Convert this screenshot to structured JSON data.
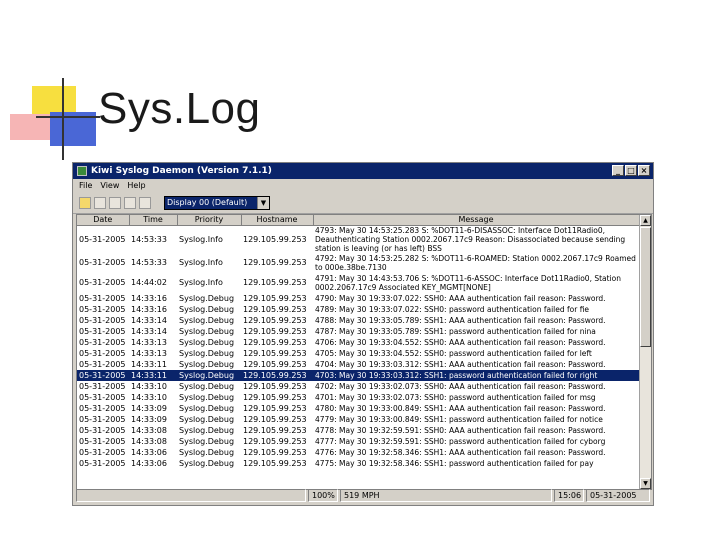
{
  "slide": {
    "title": "Sys.Log"
  },
  "window": {
    "title": "Kiwi Syslog Daemon (Version 7.1.1)",
    "buttons": {
      "minimize": "_",
      "maximize": "□",
      "close": "×"
    }
  },
  "menu": [
    "File",
    "View",
    "Help"
  ],
  "toolbar": {
    "display_value": "Display 00 (Default)"
  },
  "table": {
    "headers": [
      "Date",
      "Time",
      "Priority",
      "Hostname",
      "Message"
    ],
    "rows": [
      {
        "date": "05-31-2005",
        "time": "14:53:33",
        "priority": "Syslog.Info",
        "host": "129.105.99.253",
        "msg": "4793: May 30 14:53:25.283 S: %DOT11-6-DISASSOC: Interface Dot11Radio0, Deauthenticating Station 0002.2067.17c9 Reason: Disassociated because sending station is leaving (or has left) BSS",
        "tall": true
      },
      {
        "date": "05-31-2005",
        "time": "14:53:33",
        "priority": "Syslog.Info",
        "host": "129.105.99.253",
        "msg": "4792: May 30 14:53:25.282 S: %DOT11-6-ROAMED: Station 0002.2067.17c9 Roamed to 000e.38be.7130",
        "tall": true
      },
      {
        "date": "05-31-2005",
        "time": "14:44:02",
        "priority": "Syslog.Info",
        "host": "129.105.99.253",
        "msg": "4791: May 30 14:43:53.706 S: %DOT11-6-ASSOC: Interface Dot11Radio0, Station 0002.2067.17c9 Associated KEY_MGMT[NONE]",
        "tall": true
      },
      {
        "date": "05-31-2005",
        "time": "14:33:16",
        "priority": "Syslog.Debug",
        "host": "129.105.99.253",
        "msg": "4790: May 30 19:33:07.022: SSH0: AAA authentication fail reason: Password."
      },
      {
        "date": "05-31-2005",
        "time": "14:33:16",
        "priority": "Syslog.Debug",
        "host": "129.105.99.253",
        "msg": "4789: May 30 19:33:07.022: SSH0: password authentication failed for fie"
      },
      {
        "date": "05-31-2005",
        "time": "14:33:14",
        "priority": "Syslog.Debug",
        "host": "129.105.99.253",
        "msg": "4788: May 30 19:33:05.789: SSH1: AAA authentication fail reason: Password."
      },
      {
        "date": "05-31-2005",
        "time": "14:33:14",
        "priority": "Syslog.Debug",
        "host": "129.105.99.253",
        "msg": "4787: May 30 19:33:05.789: SSH1: password authentication failed for nina"
      },
      {
        "date": "05-31-2005",
        "time": "14:33:13",
        "priority": "Syslog.Debug",
        "host": "129.105.99.253",
        "msg": "4706: May 30 19:33:04.552: SSH0: AAA authentication fail reason: Password."
      },
      {
        "date": "05-31-2005",
        "time": "14:33:13",
        "priority": "Syslog.Debug",
        "host": "129.105.99.253",
        "msg": "4705: May 30 19:33:04.552: SSH0: password authentication failed for left"
      },
      {
        "date": "05-31-2005",
        "time": "14:33:11",
        "priority": "Syslog.Debug",
        "host": "129.105.99.253",
        "msg": "4704: May 30 19:33:03.312: SSH1: AAA authentication fail reason: Password."
      },
      {
        "date": "05-31-2005",
        "time": "14:33:11",
        "priority": "Syslog.Debug",
        "host": "129.105.99.253",
        "msg": "4703: May 30 19:33:03.312: SSH1: password authentication failed for right",
        "selected": true
      },
      {
        "date": "05-31-2005",
        "time": "14:33:10",
        "priority": "Syslog.Debug",
        "host": "129.105.99.253",
        "msg": "4702: May 30 19:33:02.073: SSH0: AAA authentication fail reason: Password."
      },
      {
        "date": "05-31-2005",
        "time": "14:33:10",
        "priority": "Syslog.Debug",
        "host": "129.105.99.253",
        "msg": "4701: May 30 19:33:02.073: SSH0: password authentication failed for msg"
      },
      {
        "date": "05-31-2005",
        "time": "14:33:09",
        "priority": "Syslog.Debug",
        "host": "129.105.99.253",
        "msg": "4780: May 30 19:33:00.849: SSH1: AAA authentication fail reason: Password."
      },
      {
        "date": "05-31-2005",
        "time": "14:33:09",
        "priority": "Syslog.Debug",
        "host": "129.105.99.253",
        "msg": "4779: May 30 19:33:00.849: SSH1: password authentication failed for notice"
      },
      {
        "date": "05-31-2005",
        "time": "14:33:08",
        "priority": "Syslog.Debug",
        "host": "129.105.99.253",
        "msg": "4778: May 30 19:32:59.591: SSH0: AAA authentication fail reason: Password."
      },
      {
        "date": "05-31-2005",
        "time": "14:33:08",
        "priority": "Syslog.Debug",
        "host": "129.105.99.253",
        "msg": "4777: May 30 19:32:59.591: SSH0: password authentication failed for cyborg"
      },
      {
        "date": "05-31-2005",
        "time": "14:33:06",
        "priority": "Syslog.Debug",
        "host": "129.105.99.253",
        "msg": "4776: May 30 19:32:58.346: SSH1: AAA authentication fail reason: Password."
      },
      {
        "date": "05-31-2005",
        "time": "14:33:06",
        "priority": "Syslog.Debug",
        "host": "129.105.99.253",
        "msg": "4775: May 30 19:32:58.346: SSH1: password authentication failed for pay"
      }
    ]
  },
  "status": {
    "percent": "100%",
    "rate": "519 MPH",
    "time": "15:06",
    "date": "05-31-2005"
  },
  "colors": {
    "titlebar": "#0a246a",
    "selection": "#0a246a"
  }
}
